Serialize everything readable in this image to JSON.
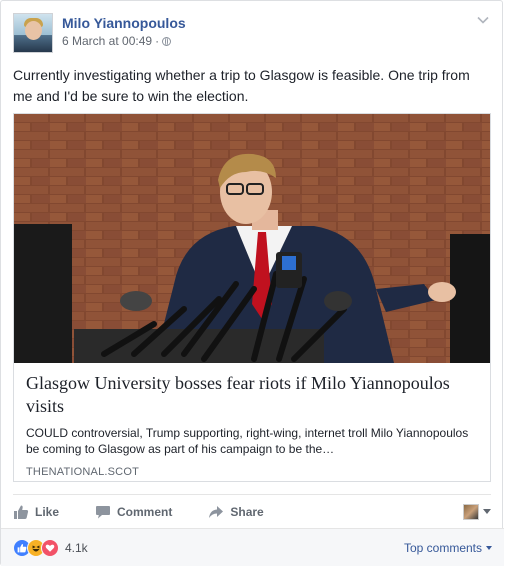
{
  "post": {
    "author": "Milo Yiannopoulos",
    "timestamp": "6 March at 00:49",
    "separator": "·",
    "privacy_icon": "globe-icon",
    "options_icon": "chevron-down-icon",
    "text": "Currently investigating whether a trip to Glasgow is feasible. One trip from me and I'd be sure to win the election."
  },
  "attachment": {
    "image_alt": "Man speaking at a podium with microphones",
    "title": "Glasgow University bosses fear riots if Milo Yiannopoulos visits",
    "description": "COULD controversial, Trump supporting, right-wing, internet troll Milo Yiannopoulos be coming to Glasgow as part of his campaign to be the…",
    "domain": "THENATIONAL.SCOT"
  },
  "actions": {
    "like": "Like",
    "comment": "Comment",
    "share": "Share",
    "like_icon": "thumbs-up-icon",
    "comment_icon": "speech-bubble-icon",
    "share_icon": "share-arrow-icon"
  },
  "reactions": {
    "types": [
      "like",
      "haha",
      "love"
    ],
    "count": "4.1k",
    "sort_label": "Top comments"
  },
  "colors": {
    "link_blue": "#365899",
    "like_blue": "#4080ff",
    "haha_yellow": "#f7b125",
    "love_red": "#f25268"
  }
}
